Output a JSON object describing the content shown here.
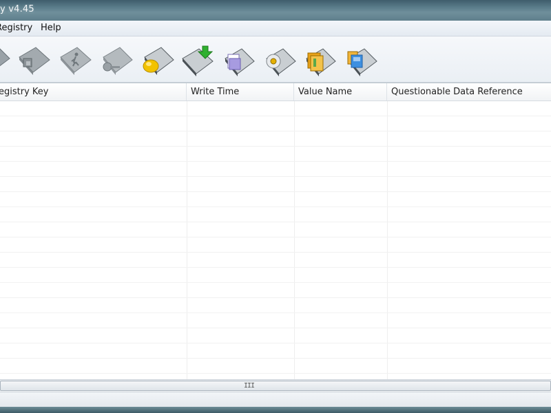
{
  "window": {
    "title": "y v4.45"
  },
  "menu": {
    "items": [
      {
        "label": "Registry"
      },
      {
        "label": "Help"
      }
    ]
  },
  "toolbar": {
    "buttons": [
      {
        "icon": "gray-folder-icon"
      },
      {
        "icon": "gray-folder-icon"
      },
      {
        "icon": "gray-folder-exit-icon"
      },
      {
        "icon": "gray-folder-settings-icon"
      },
      {
        "icon": "yellow-folder-icon"
      },
      {
        "icon": "green-arrow-folder-icon"
      },
      {
        "icon": "purple-doc-folder-icon"
      },
      {
        "icon": "cd-folder-icon"
      },
      {
        "icon": "orange-book-folder-icon"
      },
      {
        "icon": "blue-app-folder-icon"
      }
    ]
  },
  "table": {
    "columns": [
      {
        "label": "egistry Key"
      },
      {
        "label": "Write Time"
      },
      {
        "label": "Value Name"
      },
      {
        "label": "Questionable Data Reference"
      }
    ],
    "rows": []
  },
  "scrollbar": {
    "grip": "III"
  }
}
